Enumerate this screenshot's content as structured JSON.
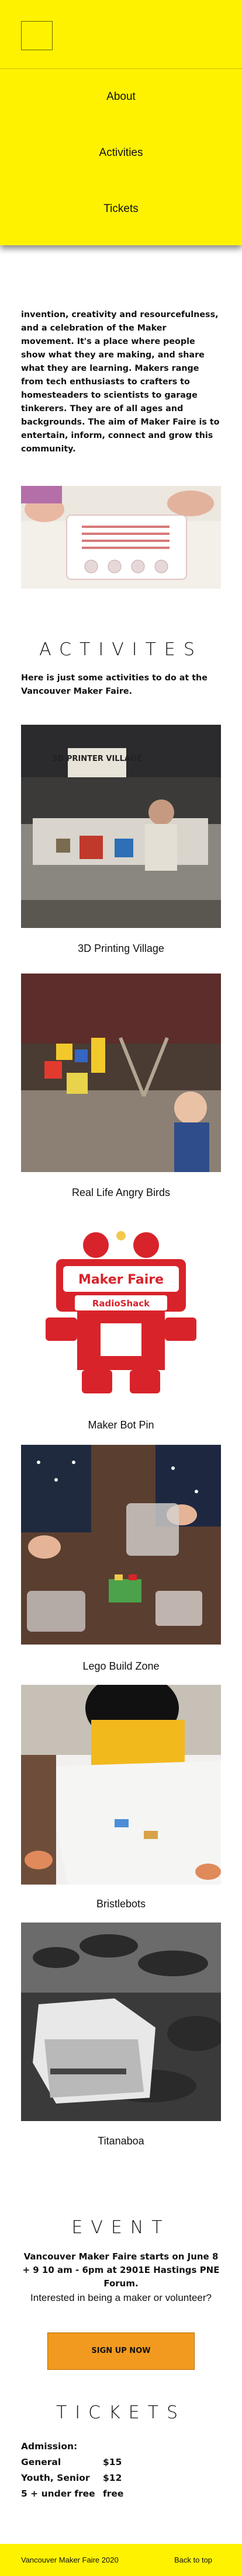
{
  "nav": {
    "logo": "logo-placeholder",
    "links": [
      {
        "label": "About"
      },
      {
        "label": "Activities"
      },
      {
        "label": "Tickets"
      }
    ]
  },
  "about": {
    "text": "invention, creativity and resourcefulness, and a celebration of the Maker movement. It's a place where people show what they are making, and share what they are learning. Makers range from tech enthusiasts to crafters to homesteaders to scientists to garage tinkerers. They are of all ages and backgrounds. The aim of Maker Faire is to entertain, inform, connect and grow this community."
  },
  "activities": {
    "heading": "ACTIVITES",
    "lead": "Here is just some activities to do at the Vancouver Maker Faire.",
    "items": [
      {
        "caption": "3D Printing Village",
        "sign": "3D PRINTER VILLAGE"
      },
      {
        "caption": "Real Life Angry Birds"
      },
      {
        "caption": "Maker Bot Pin",
        "badge_title": "Maker Faire",
        "badge_sub": "RadioShack"
      },
      {
        "caption": "Lego Build Zone"
      },
      {
        "caption": "Bristlebots"
      },
      {
        "caption": "Titanaboa"
      }
    ]
  },
  "event": {
    "heading": "EVENT",
    "details": "Vancouver Maker Faire starts on June 8 + 9 10 am - 6pm at 2901E Hastings PNE Forum.",
    "prompt": "Interested in being a maker or volunteer?",
    "button": "SIGN UP NOW"
  },
  "tickets": {
    "heading": "TICKETS",
    "title": "Admission:",
    "rows": [
      {
        "label": "General",
        "price": "$15"
      },
      {
        "label": "Youth, Senior",
        "price": "$12"
      },
      {
        "label": "5 + under free",
        "price": "free"
      }
    ]
  },
  "footer": {
    "copyright": "Vancouver Maker Faire 2020",
    "back_to_top": "Back to top"
  },
  "colors": {
    "accent_yellow": "#fff200",
    "button_orange": "#f29a1f",
    "badge_red": "#d8232a"
  }
}
